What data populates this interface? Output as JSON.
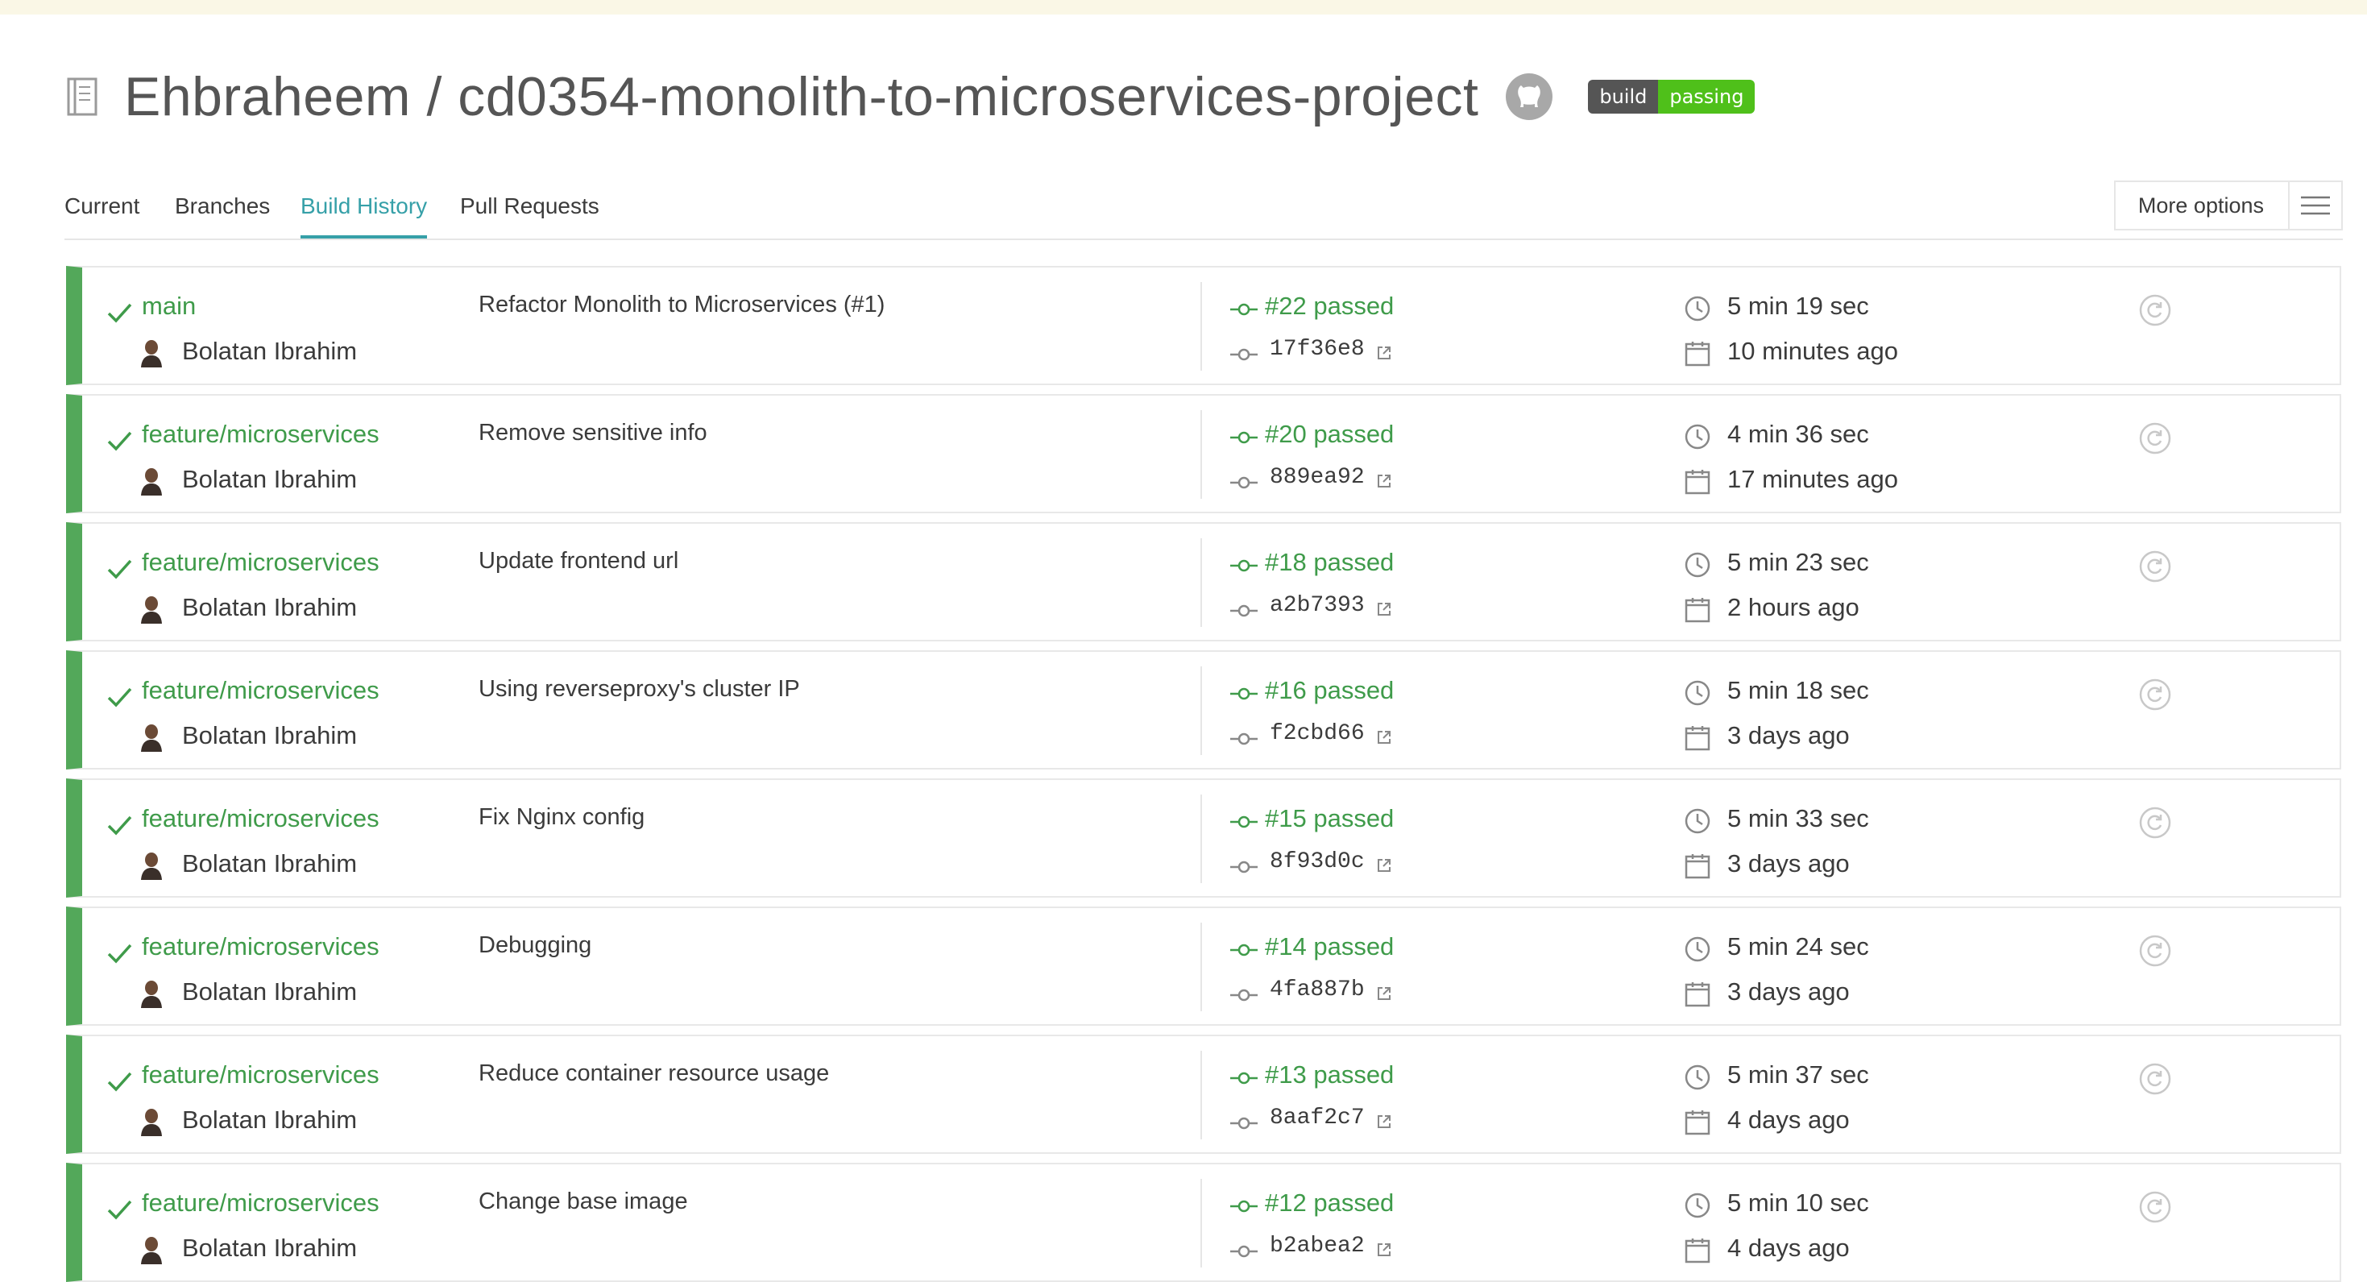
{
  "repo": {
    "title": "Ehbraheem / cd0354-monolith-to-microservices-project",
    "badge_left": "build",
    "badge_right": "passing",
    "icon": "repo-book-icon",
    "github_icon": "github-icon"
  },
  "tabs": [
    {
      "label": "Current",
      "active": false
    },
    {
      "label": "Branches",
      "active": false
    },
    {
      "label": "Build History",
      "active": true
    },
    {
      "label": "Pull Requests",
      "active": false
    }
  ],
  "more_options": {
    "label": "More options",
    "icon": "hamburger-menu-icon"
  },
  "colors": {
    "passed": "#3f9b4a",
    "row_stripe": "#53a85a",
    "active_tab": "#36a0a8",
    "badge_passing": "#4fc01a"
  },
  "builds": [
    {
      "branch": "main",
      "author": "Bolatan Ibrahim",
      "message": "Refactor Monolith to Microservices (#1)",
      "build": "#22 passed",
      "sha": "17f36e8",
      "duration": "5 min 19 sec",
      "finished": "10 minutes ago"
    },
    {
      "branch": "feature/microservices",
      "author": "Bolatan Ibrahim",
      "message": "Remove sensitive info",
      "build": "#20 passed",
      "sha": "889ea92",
      "duration": "4 min 36 sec",
      "finished": "17 minutes ago"
    },
    {
      "branch": "feature/microservices",
      "author": "Bolatan Ibrahim",
      "message": "Update frontend url",
      "build": "#18 passed",
      "sha": "a2b7393",
      "duration": "5 min 23 sec",
      "finished": "2 hours ago"
    },
    {
      "branch": "feature/microservices",
      "author": "Bolatan Ibrahim",
      "message": "Using reverseproxy's cluster IP",
      "build": "#16 passed",
      "sha": "f2cbd66",
      "duration": "5 min 18 sec",
      "finished": "3 days ago"
    },
    {
      "branch": "feature/microservices",
      "author": "Bolatan Ibrahim",
      "message": "Fix Nginx config",
      "build": "#15 passed",
      "sha": "8f93d0c",
      "duration": "5 min 33 sec",
      "finished": "3 days ago"
    },
    {
      "branch": "feature/microservices",
      "author": "Bolatan Ibrahim",
      "message": "Debugging",
      "build": "#14 passed",
      "sha": "4fa887b",
      "duration": "5 min 24 sec",
      "finished": "3 days ago"
    },
    {
      "branch": "feature/microservices",
      "author": "Bolatan Ibrahim",
      "message": "Reduce container resource usage",
      "build": "#13 passed",
      "sha": "8aaf2c7",
      "duration": "5 min 37 sec",
      "finished": "4 days ago"
    },
    {
      "branch": "feature/microservices",
      "author": "Bolatan Ibrahim",
      "message": "Change base image",
      "build": "#12 passed",
      "sha": "b2abea2",
      "duration": "5 min 10 sec",
      "finished": "4 days ago"
    }
  ]
}
